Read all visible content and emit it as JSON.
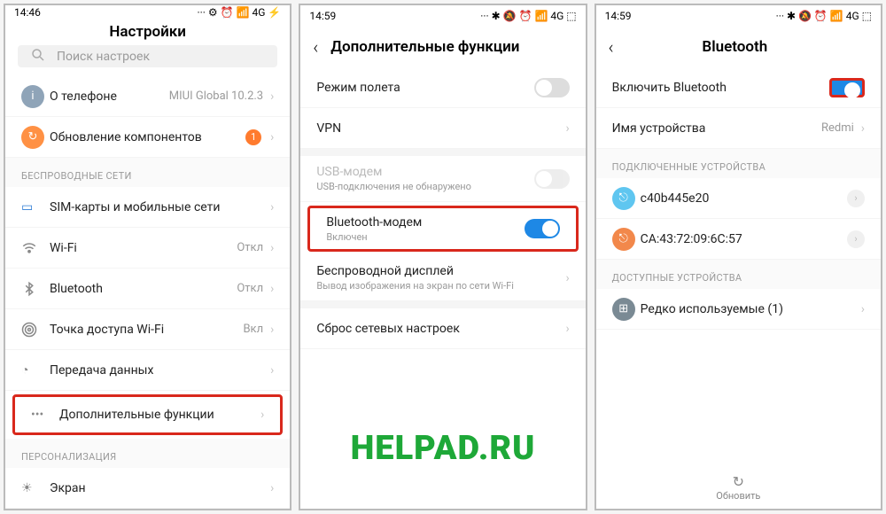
{
  "overlay": "HELPAD.RU",
  "panel1": {
    "time": "14:46",
    "status_icons": "··· ⚙ ⏰ 📶 4G ⚡",
    "title": "Настройки",
    "search_placeholder": "Поиск настроек",
    "about": {
      "label": "О телефоне",
      "value": "MIUI Global 10.2.3"
    },
    "update": {
      "label": "Обновление компонентов",
      "badge": "1"
    },
    "section_wireless": "БЕСПРОВОДНЫЕ СЕТИ",
    "sim": "SIM-карты и мобильные сети",
    "wifi": {
      "label": "Wi-Fi",
      "value": "Откл"
    },
    "bt": {
      "label": "Bluetooth",
      "value": "Откл"
    },
    "hotspot": {
      "label": "Точка доступа Wi-Fi",
      "value": "Вкл"
    },
    "data": "Передача данных",
    "more": "Дополнительные функции",
    "section_personal": "ПЕРСОНАЛИЗАЦИЯ",
    "screen": "Экран"
  },
  "panel2": {
    "time": "14:59",
    "status_icons": "··· ✱ 🔕 ⏰ 📶 4G ⬚",
    "title": "Дополнительные функции",
    "airplane": "Режим полета",
    "vpn": "VPN",
    "usb": {
      "label": "USB-модем",
      "sub": "USB-подключения не обнаружено"
    },
    "btmodem": {
      "label": "Bluetooth-модем",
      "sub": "Включен"
    },
    "cast": {
      "label": "Беспроводной дисплей",
      "sub": "Вывод изображения на экран по сети Wi-Fi"
    },
    "reset": "Сброс сетевых настроек"
  },
  "panel3": {
    "time": "14:59",
    "status_icons": "··· ✱ 🔕 ⏰ 📶 4G ⬚",
    "title": "Bluetooth",
    "enable": "Включить Bluetooth",
    "devicename": {
      "label": "Имя устройства",
      "value": "Redmi"
    },
    "section_conn": "ПОДКЛЮЧЕННЫЕ УСТРОЙСТВА",
    "dev1": "c40b445e20",
    "dev2": "CA:43:72:09:6C:57",
    "section_avail": "ДОСТУПНЫЕ УСТРОЙСТВА",
    "rare": "Редко используемые (1)",
    "refresh": "Обновить"
  }
}
